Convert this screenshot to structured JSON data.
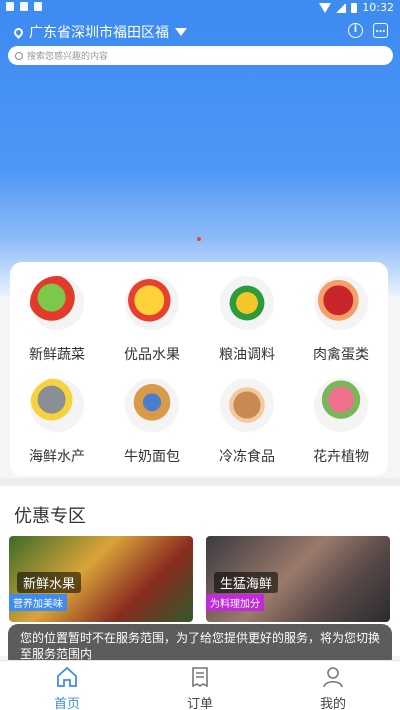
{
  "status_bar": {
    "time": "10:32"
  },
  "header": {
    "location": "广东省深圳市福田区福",
    "search_placeholder": "搜索您感兴趣的内容"
  },
  "categories": [
    {
      "label": "新鲜蔬菜",
      "icon": "vegetables-icon"
    },
    {
      "label": "优品水果",
      "icon": "fruits-icon"
    },
    {
      "label": "粮油调料",
      "icon": "oil-seasoning-icon"
    },
    {
      "label": "肉禽蛋类",
      "icon": "meat-eggs-icon"
    },
    {
      "label": "海鲜水产",
      "icon": "seafood-icon"
    },
    {
      "label": "牛奶面包",
      "icon": "milk-bread-icon"
    },
    {
      "label": "冷冻食品",
      "icon": "frozen-food-icon"
    },
    {
      "label": "花卉植物",
      "icon": "flowers-icon"
    }
  ],
  "promo": {
    "title": "优惠专区",
    "cards": [
      {
        "name": "新鲜水果",
        "tag": "营养加美味",
        "tag_color": "#3f8cf0"
      },
      {
        "name": "生猛海鲜",
        "tag": "为料理加分",
        "tag_color": "#c02ad8"
      }
    ]
  },
  "toast": "您的位置暂时不在服务范围，为了给您提供更好的服务，将为您切换至服务范围内",
  "tabs": [
    {
      "label": "首页",
      "icon": "home-icon",
      "active": true
    },
    {
      "label": "订单",
      "icon": "order-icon",
      "active": false
    },
    {
      "label": "我的",
      "icon": "profile-icon",
      "active": false
    }
  ],
  "colors": {
    "accent": "#3f8cf0"
  }
}
